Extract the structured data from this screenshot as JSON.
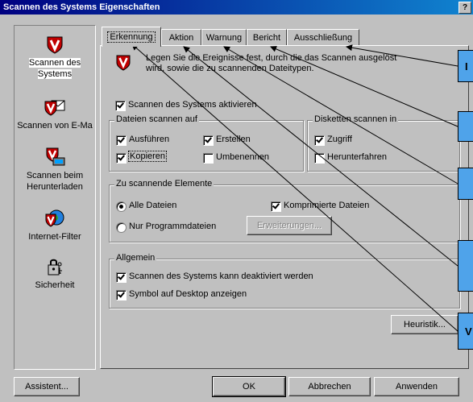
{
  "window": {
    "title": "Scannen des Systems Eigenschaften",
    "help_label": "?"
  },
  "sidebar": {
    "items": [
      {
        "label": "Scannen des Systems",
        "icon": "shield-v-icon",
        "selected": true
      },
      {
        "label": "Scannen von E-Ma",
        "icon": "mail-shield-icon"
      },
      {
        "label": "Scannen beim Herunterladen",
        "icon": "download-shield-icon"
      },
      {
        "label": "Internet-Filter",
        "icon": "globe-shield-icon"
      },
      {
        "label": "Sicherheit",
        "icon": "lock-icon"
      }
    ]
  },
  "tabs": [
    {
      "label": "Erkennung",
      "active": true
    },
    {
      "label": "Aktion"
    },
    {
      "label": "Warnung"
    },
    {
      "label": "Bericht"
    },
    {
      "label": "Ausschließung"
    }
  ],
  "panel": {
    "description": "Legen Sie die Ereignisse fest, durch die das Scannen ausgelöst wird, sowie die zu scannenden Dateitypen.",
    "enable_scan": {
      "label": "Scannen des Systems aktivieren",
      "checked": true
    },
    "files_group": {
      "title": "Dateien scannen auf",
      "items": [
        {
          "label": "Ausführen",
          "checked": true
        },
        {
          "label": "Erstellen",
          "checked": true
        },
        {
          "label": "Kopieren",
          "checked": true
        },
        {
          "label": "Umbenennen",
          "checked": false
        }
      ]
    },
    "disk_group": {
      "title": "Disketten scannen in",
      "items": [
        {
          "label": "Zugriff",
          "checked": true
        },
        {
          "label": "Herunterfahren",
          "checked": false
        }
      ]
    },
    "elements_group": {
      "title": "Zu scannende Elemente",
      "all_files": {
        "label": "Alle Dateien",
        "selected": true
      },
      "program_files": {
        "label": "Nur Programmdateien",
        "selected": false
      },
      "compressed": {
        "label": "Komprimierte Dateien",
        "checked": true
      },
      "extensions_button": "Erweiterungen..."
    },
    "general_group": {
      "title": "Allgemein",
      "items": [
        {
          "label": "Scannen des Systems kann deaktiviert werden",
          "checked": true
        },
        {
          "label": "Symbol auf Desktop anzeigen",
          "checked": true
        }
      ]
    },
    "heuristic_button": "Heuristik..."
  },
  "footer": {
    "assistant_button": "Assistent...",
    "ok_button": "OK",
    "cancel_button": "Abbrechen",
    "apply_button": "Anwenden"
  },
  "callouts": {
    "labels": [
      "I",
      "",
      "",
      "",
      "V"
    ],
    "color": "#4fa3ea"
  }
}
